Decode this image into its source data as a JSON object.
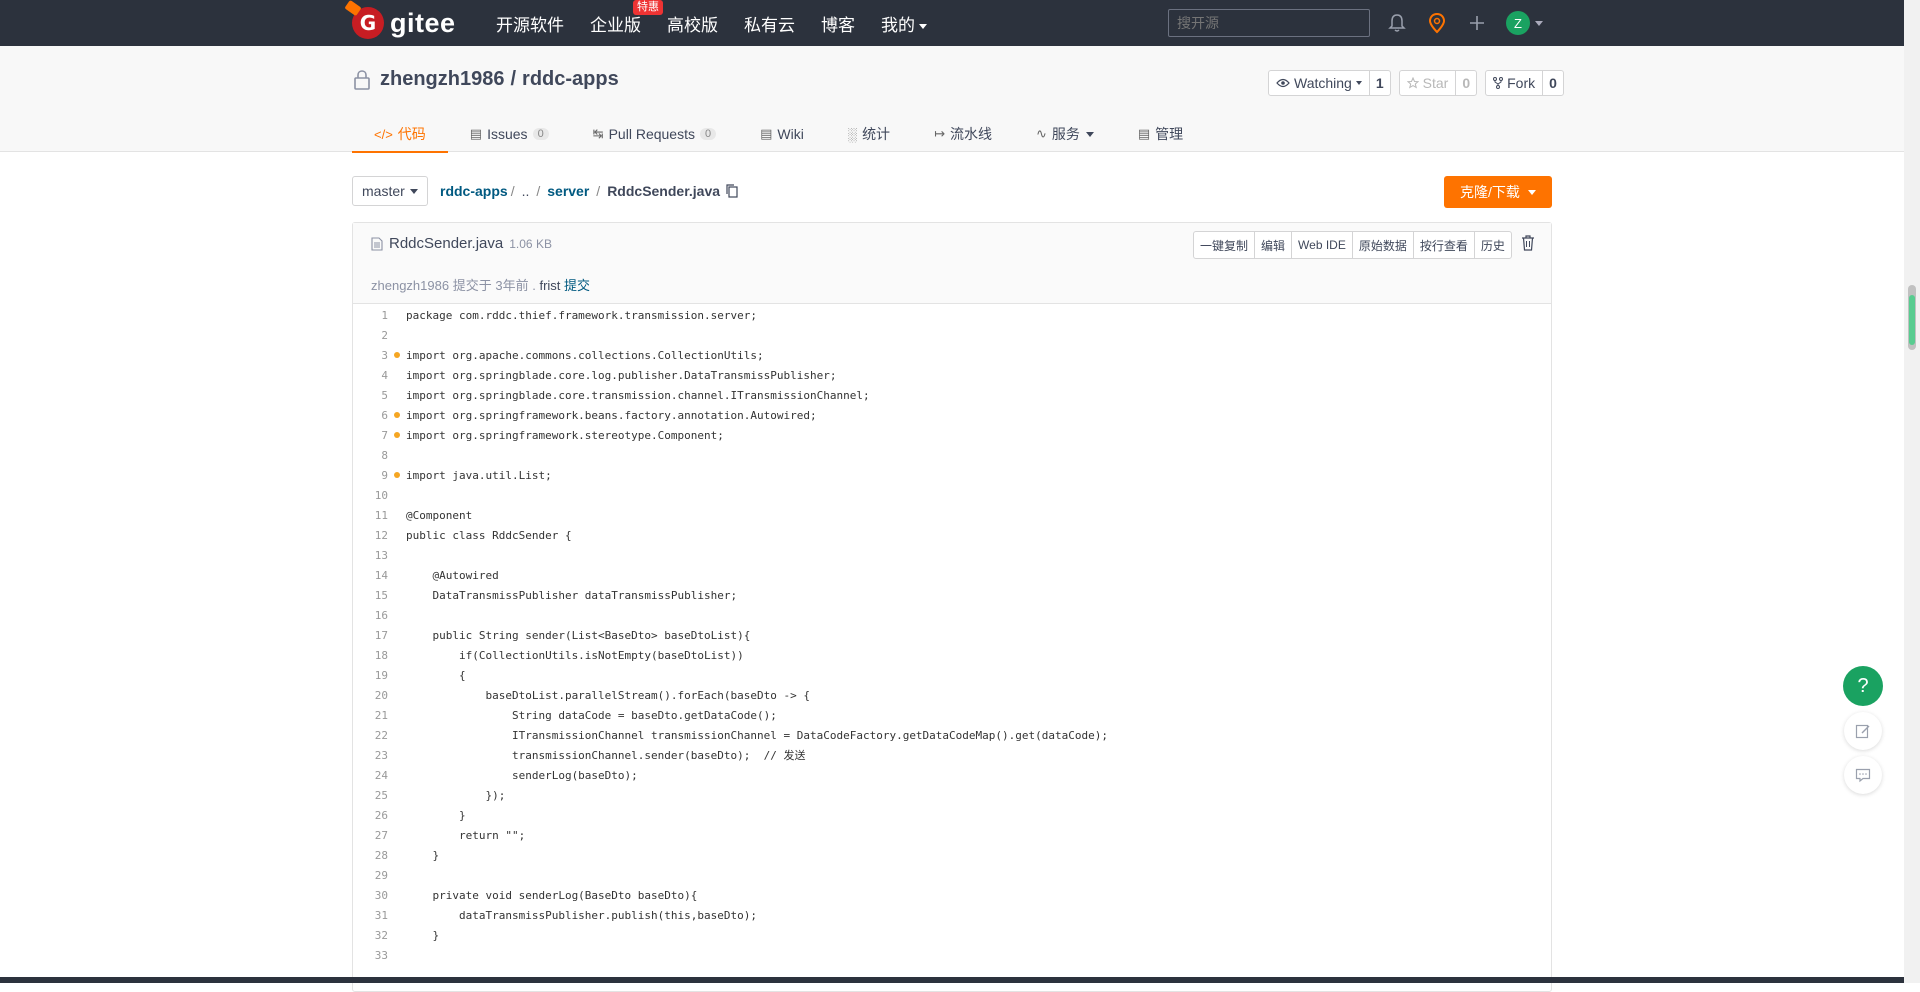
{
  "topnav": {
    "logo_text": "gitee",
    "links": [
      {
        "label": "开源软件"
      },
      {
        "label": "企业版",
        "badge": "特惠"
      },
      {
        "label": "高校版"
      },
      {
        "label": "私有云"
      },
      {
        "label": "博客"
      },
      {
        "label": "我的"
      }
    ],
    "search_placeholder": "搜开源",
    "avatar_letter": "Z",
    "icons": [
      "bell-icon",
      "map-pin-icon",
      "plus-icon"
    ]
  },
  "project": {
    "owner": "zhengzh1986",
    "separator": "/",
    "name": "rddc-apps",
    "watch_label": "Watching",
    "watch_count": "1",
    "star_label": "Star",
    "star_count": "0",
    "fork_label": "Fork",
    "fork_count": "0"
  },
  "tabs": [
    {
      "label": "代码",
      "icon": "</>"
    },
    {
      "label": "Issues",
      "count": "0"
    },
    {
      "label": "Pull Requests",
      "count": "0"
    },
    {
      "label": "Wiki"
    },
    {
      "label": "统计"
    },
    {
      "label": "流水线"
    },
    {
      "label": "服务"
    },
    {
      "label": "管理"
    }
  ],
  "breadcrumb": {
    "branch": "master",
    "root": "rddc-apps",
    "up": "..",
    "dir": "server",
    "file": "RddcSender.java",
    "sep": "/"
  },
  "clone_label": "克隆/下载",
  "file": {
    "name": "RddcSender.java",
    "size": "1.06 KB",
    "tools": [
      "一键复制",
      "编辑",
      "Web IDE",
      "原始数据",
      "按行查看",
      "历史"
    ],
    "commit_author": "zhengzh1986",
    "commit_text": "提交于",
    "commit_time": "3年前",
    "commit_dot": ".",
    "commit_msg": "frist",
    "commit_link": "提交"
  },
  "code_lines": [
    {
      "n": "1",
      "t": "package com.rddc.thief.framework.transmission.server;"
    },
    {
      "n": "2",
      "t": ""
    },
    {
      "n": "3",
      "t": "import org.apache.commons.collections.CollectionUtils;",
      "dot": true
    },
    {
      "n": "4",
      "t": "import org.springblade.core.log.publisher.DataTransmissPublisher;"
    },
    {
      "n": "5",
      "t": "import org.springblade.core.transmission.channel.ITransmissionChannel;"
    },
    {
      "n": "6",
      "t": "import org.springframework.beans.factory.annotation.Autowired;",
      "dot": true
    },
    {
      "n": "7",
      "t": "import org.springframework.stereotype.Component;",
      "dot": true
    },
    {
      "n": "8",
      "t": ""
    },
    {
      "n": "9",
      "t": "import java.util.List;",
      "dot": true
    },
    {
      "n": "10",
      "t": ""
    },
    {
      "n": "11",
      "t": "@Component"
    },
    {
      "n": "12",
      "t": "public class RddcSender {"
    },
    {
      "n": "13",
      "t": ""
    },
    {
      "n": "14",
      "t": "    @Autowired"
    },
    {
      "n": "15",
      "t": "    DataTransmissPublisher dataTransmissPublisher;"
    },
    {
      "n": "16",
      "t": ""
    },
    {
      "n": "17",
      "t": "    public String sender(List<BaseDto> baseDtoList){"
    },
    {
      "n": "18",
      "t": "        if(CollectionUtils.isNotEmpty(baseDtoList))"
    },
    {
      "n": "19",
      "t": "        {"
    },
    {
      "n": "20",
      "t": "            baseDtoList.parallelStream().forEach(baseDto -> {"
    },
    {
      "n": "21",
      "t": "                String dataCode = baseDto.getDataCode();"
    },
    {
      "n": "22",
      "t": "                ITransmissionChannel transmissionChannel = DataCodeFactory.getDataCodeMap().get(dataCode);"
    },
    {
      "n": "23",
      "t": "                transmissionChannel.sender(baseDto);  // 发送"
    },
    {
      "n": "24",
      "t": "                senderLog(baseDto);"
    },
    {
      "n": "25",
      "t": "            });"
    },
    {
      "n": "26",
      "t": "        }"
    },
    {
      "n": "27",
      "t": "        return \"\";"
    },
    {
      "n": "28",
      "t": "    }"
    },
    {
      "n": "29",
      "t": ""
    },
    {
      "n": "30",
      "t": "    private void senderLog(BaseDto baseDto){"
    },
    {
      "n": "31",
      "t": "        dataTransmissPublisher.publish(this,baseDto);"
    },
    {
      "n": "32",
      "t": "    }"
    },
    {
      "n": "33",
      "t": ""
    }
  ],
  "float": {
    "help_label": "?",
    "icons": [
      "help-icon",
      "edit-note-icon",
      "comment-icon"
    ]
  },
  "colors": {
    "nav_bg": "#2c323d",
    "accent": "#fe7300",
    "link": "#005980",
    "green": "#1aa261"
  }
}
